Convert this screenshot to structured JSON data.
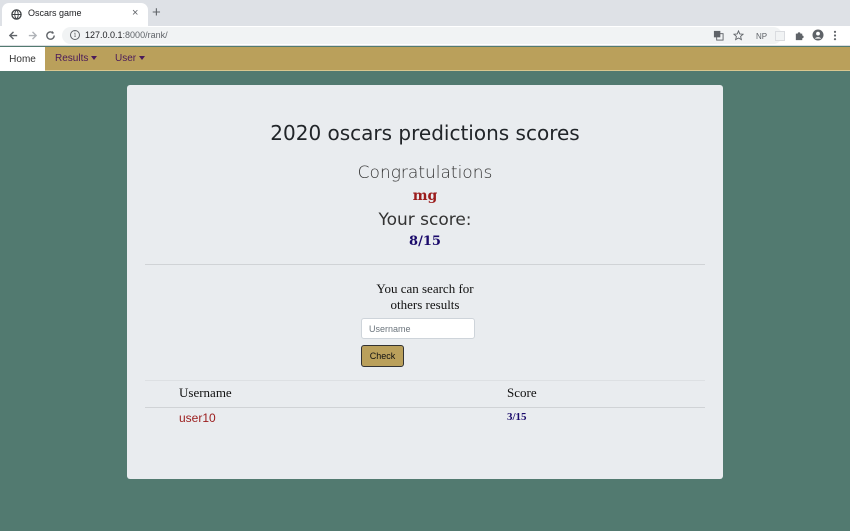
{
  "browser": {
    "tab_title": "Oscars game",
    "url_host": "127.0.0.1",
    "url_path": ":8000/rank/",
    "new_tab_symbol": "+",
    "close_symbol": "×",
    "ext_np": "NP"
  },
  "navbar": {
    "home": "Home",
    "results": "Results",
    "user": "User"
  },
  "page": {
    "title": "2020 oscars predictions scores",
    "congrats": "Congratulations",
    "username": "mg",
    "your_score_label": "Your score:",
    "your_score": "8/15",
    "search_line1": "You can search for",
    "search_line2": "others results",
    "search_placeholder": "Username",
    "check_label": "Check"
  },
  "table": {
    "headers": [
      "Username",
      "Score"
    ],
    "rows": [
      {
        "username": "user10",
        "score": "3/15"
      }
    ]
  },
  "colors": {
    "background": "#527a70",
    "navbar": "#baa05b",
    "accent_red": "#9b1c1c",
    "accent_blue": "#1a0a6b"
  }
}
